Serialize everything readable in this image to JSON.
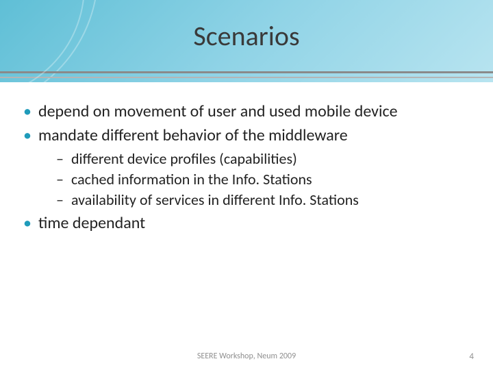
{
  "title": "Scenarios",
  "bullets": {
    "b1": "depend on movement of user and used mobile device",
    "b2": "mandate different behavior of the middleware",
    "b2a": "different device profiles (capabilities)",
    "b2b": "cached information in the Info. Stations",
    "b2c": "availability of services in different Info. Stations",
    "b3": "time dependant"
  },
  "footer": {
    "center": "SEERE Workshop, Neum 2009",
    "page": "4"
  }
}
